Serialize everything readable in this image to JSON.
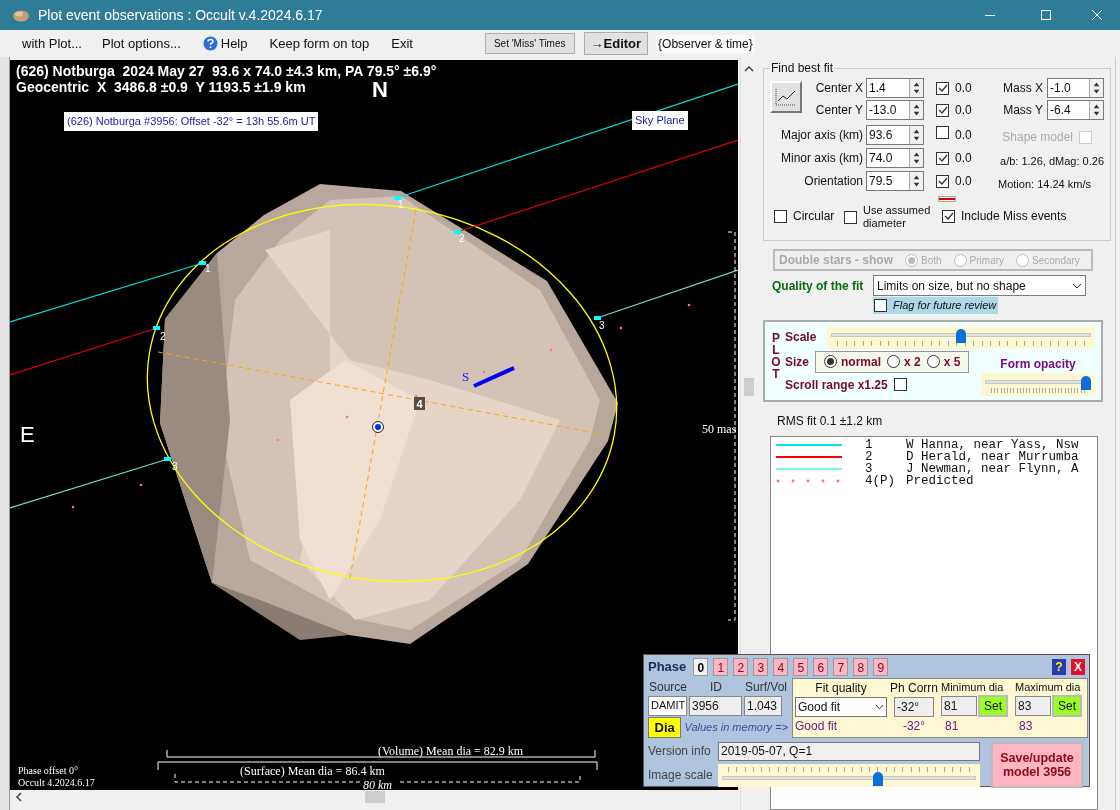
{
  "window": {
    "title": "Plot event observations : Occult v.4.2024.6.17"
  },
  "menu": [
    {
      "kind": "text",
      "label": "with Plot..."
    },
    {
      "kind": "text",
      "label": "Plot options..."
    },
    {
      "kind": "help",
      "label": "Help"
    },
    {
      "kind": "text",
      "label": "Keep form on top"
    },
    {
      "kind": "text",
      "label": "Exit"
    }
  ],
  "toolbar": [
    {
      "kind": "small",
      "label": "Set 'Miss' Times"
    },
    {
      "kind": "bold",
      "label": "→Editor"
    },
    {
      "kind": "plain",
      "label": "{Observer & time}"
    }
  ],
  "plot": {
    "header": [
      "(626) Notburga  2024 May 27  93.6 x 74.0 ±4.3 km, PA 79.5° ±6.9°",
      "Geocentric  X  3486.8 ±0.9  Y 1193.5 ±1.9 km"
    ],
    "north": "N",
    "east": "E",
    "offset_label": "(626) Notburga #3956: Offset -32° = 13h 55.6m UT",
    "sky_plane": "Sky Plane",
    "scale_label": "50 mas",
    "chords": [
      {
        "color": "#00e0e0",
        "labels": [
          "1",
          "1"
        ]
      },
      {
        "color": "#e00000",
        "labels": [
          "2",
          "2"
        ]
      },
      {
        "color": "#70e0c0",
        "labels": [
          "3",
          "3"
        ]
      }
    ],
    "predicted_label": "4",
    "motion_label": "S",
    "volume_dia": "(Volume) Mean dia = 82.9 km",
    "surface_dia": "(Surface) Mean dia = 86.4 km",
    "km_scale": "80 km",
    "phase_offset": "Phase offset 0°",
    "version": "Occult 4.2024.6.17"
  },
  "fit": {
    "title": "Find best fit",
    "params": [
      {
        "label": "Center X",
        "value": "1.4",
        "checked": true,
        "step": "0.0"
      },
      {
        "label": "Center Y",
        "value": "-13.0",
        "checked": true,
        "step": "0.0"
      },
      {
        "label": "Major axis (km)",
        "value": "93.6",
        "checked": false,
        "step": "0.0"
      },
      {
        "label": "Minor axis (km)",
        "value": "74.0",
        "checked": true,
        "step": "0.0"
      },
      {
        "label": "Orientation",
        "value": "79.5",
        "checked": true,
        "step": "0.0"
      }
    ],
    "mass": [
      {
        "label": "Mass X",
        "value": "-1.0"
      },
      {
        "label": "Mass Y",
        "value": "-6.4"
      }
    ],
    "shape_model": {
      "label": "Shape model",
      "checked": false
    },
    "ratio": "a/b: 1.26, dMag: 0.26",
    "motion": "Motion: 14.24 km/s",
    "options": [
      {
        "label": "Circular",
        "checked": false
      },
      {
        "label": "Use assumed diameter",
        "checked": false
      },
      {
        "label": "Include Miss events",
        "checked": true
      }
    ]
  },
  "double_stars": {
    "label": "Double stars - show",
    "options": [
      {
        "label": "Both",
        "selected": true
      },
      {
        "label": "Primary",
        "selected": false
      },
      {
        "label": "Secondary",
        "selected": false
      }
    ]
  },
  "quality": {
    "label": "Quality of the fit",
    "value": "Limits on size, but no shape"
  },
  "flag": {
    "label": "Flag for future review",
    "checked": false
  },
  "plot_panel": {
    "side_label": "PLOT",
    "scale": {
      "label": "Scale",
      "level": 0.5
    },
    "size": {
      "label": "Size",
      "options": [
        {
          "label": "normal",
          "selected": true
        },
        {
          "label": "x 2",
          "selected": false
        },
        {
          "label": "x 5",
          "selected": false
        }
      ]
    },
    "opacity": {
      "label": "Form opacity",
      "level": 1.0
    },
    "scroll_range": {
      "label": "Scroll range x1.25",
      "checked": false
    }
  },
  "rms": "RMS fit 0.1 ±1.2 km",
  "legend": [
    {
      "kind": "line",
      "color": "#00e5e5",
      "number": "1",
      "observer": "W Hanna, near Yass, Nsw"
    },
    {
      "kind": "line",
      "color": "#ff0000",
      "number": "2",
      "observer": "D Herald, near Murrumba"
    },
    {
      "kind": "line",
      "color": "#7fffd4",
      "number": "3",
      "observer": "J Newman, near Flynn, A"
    },
    {
      "kind": "dots",
      "color": "#ff69b4",
      "number": "4(P)",
      "observer": "Predicted"
    }
  ],
  "phase": {
    "title": "Phase",
    "phases": [
      {
        "label": "0",
        "selected": true
      },
      {
        "label": "1",
        "selected": false
      },
      {
        "label": "2",
        "selected": false
      },
      {
        "label": "3",
        "selected": false
      },
      {
        "label": "4",
        "selected": false
      },
      {
        "label": "5",
        "selected": false
      },
      {
        "label": "6",
        "selected": false
      },
      {
        "label": "7",
        "selected": false
      },
      {
        "label": "8",
        "selected": false
      },
      {
        "label": "9",
        "selected": false
      }
    ],
    "help": "?",
    "close": "X",
    "source": {
      "label": "Source",
      "value": "DAMIT"
    },
    "id": {
      "label": "ID",
      "value": "3956"
    },
    "surf_vol": {
      "label": "Surf/Vol",
      "value": "1.043"
    },
    "dia_button": "Dia",
    "memory_label": "Values in memory =>",
    "fit_quality": {
      "label": "Fit quality",
      "value": "Good fit",
      "memory": "Good fit"
    },
    "ph_corr": {
      "label": "Ph Corrn",
      "value": "-32°",
      "memory": "-32°"
    },
    "min_dia": {
      "label": "Minimum dia",
      "value": "81",
      "memory": "81",
      "button": "Set"
    },
    "max_dia": {
      "label": "Maximum dia",
      "value": "83",
      "memory": "83",
      "button": "Set"
    },
    "version_info": {
      "label": "Version info",
      "value": "2019-05-07, Q=1"
    },
    "image_scale": {
      "label": "Image scale",
      "level": 0.62
    },
    "save_button": "Save/update model 3956"
  }
}
